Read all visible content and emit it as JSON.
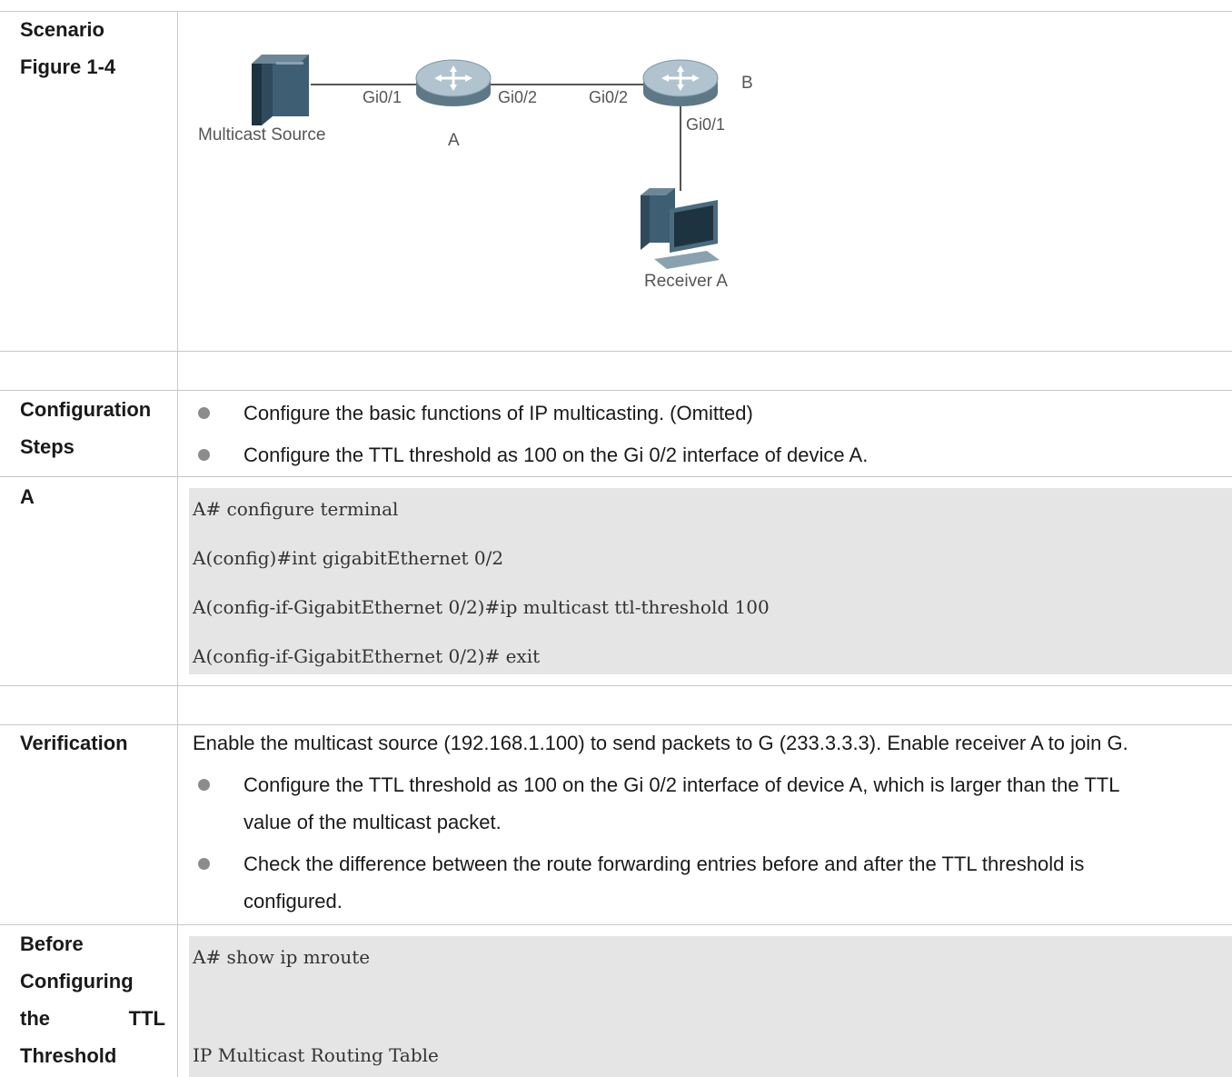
{
  "scenario": {
    "label_line1": "Scenario",
    "label_line2": "Figure 1-4",
    "diagram": {
      "source_label": "Multicast Source",
      "router_a_label": "A",
      "router_b_label": "B",
      "receiver_label": "Receiver A",
      "a_port_left": "Gi0/1",
      "a_port_right": "Gi0/2",
      "b_port_left": "Gi0/2",
      "b_port_down": "Gi0/1"
    }
  },
  "config_steps": {
    "label_line1": "Configuration",
    "label_line2": "Steps",
    "items": [
      "Configure the basic functions of IP multicasting. (Omitted)",
      "Configure the TTL threshold as 100 on the Gi 0/2 interface of device A."
    ]
  },
  "device_a": {
    "label": "A",
    "code_lines": [
      "A# configure terminal",
      "A(config)#int gigabitEthernet 0/2",
      "A(config-if-GigabitEthernet 0/2)#ip multicast ttl-threshold 100",
      "A(config-if-GigabitEthernet 0/2)# exit"
    ]
  },
  "verification": {
    "label": "Verification",
    "intro": "Enable the multicast source (192.168.1.100) to send packets to G (233.3.3.3). Enable receiver A to join G.",
    "items": [
      {
        "line1": "Configure the TTL threshold as 100 on the Gi 0/2 interface of device A, which is larger than the TTL",
        "line2": "value of the multicast packet."
      },
      {
        "line1": "Check the difference between the route forwarding entries before and after the TTL threshold is",
        "line2": "configured."
      }
    ]
  },
  "before": {
    "label_line1": "Before",
    "label_line2": "Configuring",
    "label_line3a": "the",
    "label_line3b": "TTL",
    "label_line4": "Threshold",
    "code_lines": [
      "A# show ip mroute",
      "IP Multicast Routing Table"
    ]
  }
}
